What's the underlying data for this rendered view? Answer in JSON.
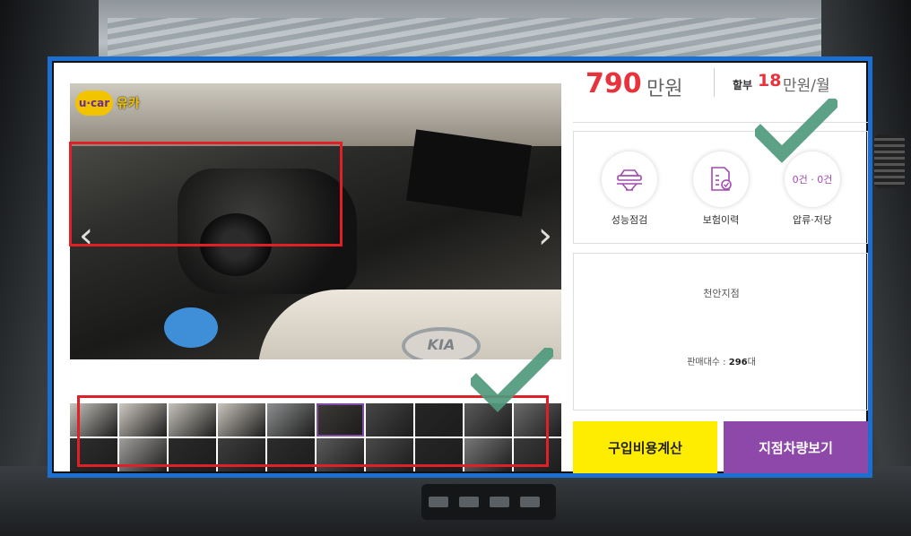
{
  "gallery": {
    "badge_logo": "u·car",
    "badge_text": "유카",
    "prev_arrow": "‹",
    "next_arrow": "›",
    "brand_logo": "KIA",
    "thumbnail_rows": [
      [
        "#c9c6bf",
        "#cfcac2",
        "#c7c3bb",
        "#c9c4bc",
        "#8d8e8f",
        "#3d3a36",
        "#474747",
        "#262626",
        "#595959",
        "#6b6b6b"
      ],
      [
        "#2f2f2f",
        "#a19f9c",
        "#2a2a2a",
        "#3d3d3d",
        "#2c2c2c",
        "#5b5b5b",
        "#4a4a4a",
        "#262626",
        "#777777",
        "#3a3a3a"
      ]
    ],
    "active_thumbnail": 5
  },
  "pricing": {
    "price": "790",
    "price_unit": "만원",
    "installment_label": "할부",
    "installment_value": "18",
    "installment_unit": "만원/월"
  },
  "features": [
    {
      "label": "성능점검",
      "icon": "car-lift-icon"
    },
    {
      "label": "보험이력",
      "icon": "insurance-document-icon"
    },
    {
      "label": "압류·저당",
      "value": "0건 · 0건"
    }
  ],
  "branch": {
    "name": "천안지점",
    "sales_label": "판매대수 :",
    "sales_count": "296",
    "sales_unit": "대"
  },
  "buttons": {
    "calc": "구입비용계산",
    "branch_cars": "지점차량보기"
  },
  "colors": {
    "frame_border": "#1a6fd1",
    "highlight": "#e01f26",
    "price_red": "#e8323c",
    "accent_purple": "#8e48a9",
    "calc_yellow": "#ffed00",
    "checkmark": "#4f9a7d"
  }
}
